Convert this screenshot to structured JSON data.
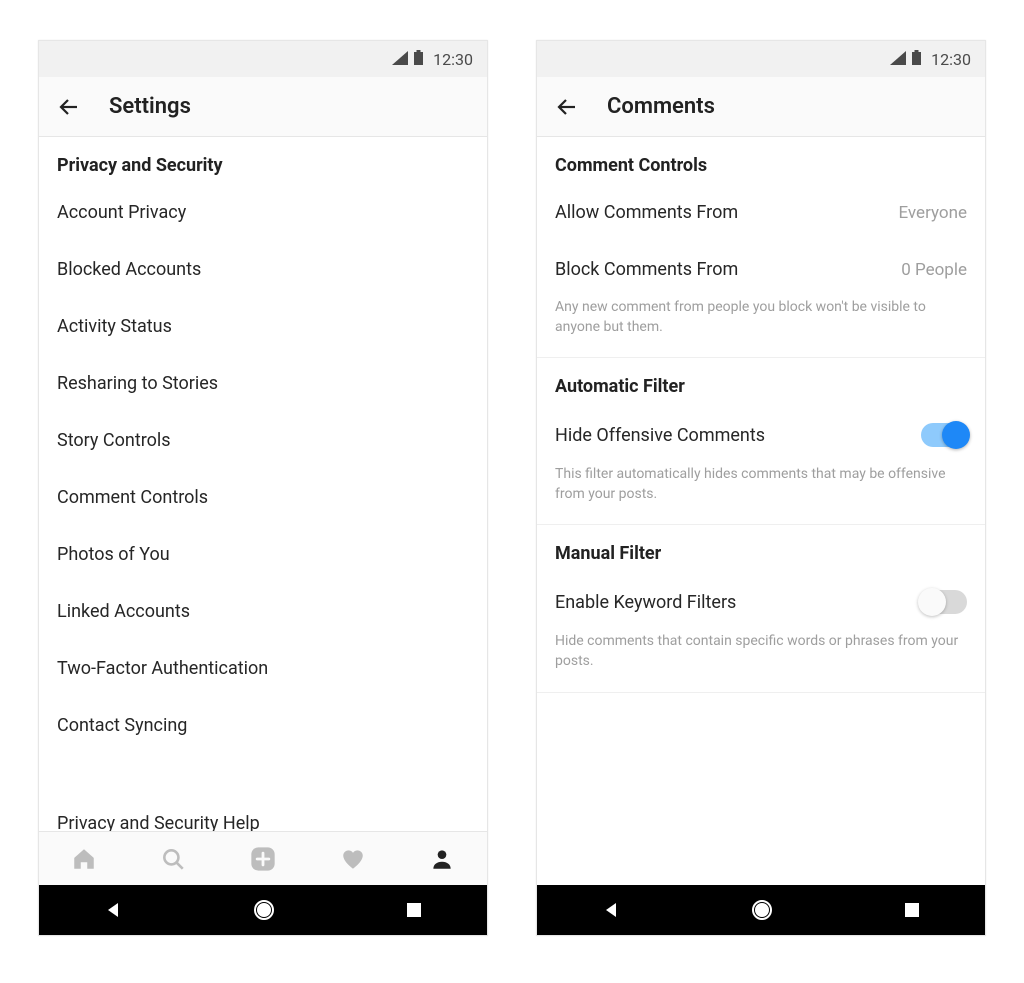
{
  "status": {
    "time": "12:30"
  },
  "left": {
    "header_title": "Settings",
    "section_title": "Privacy and Security",
    "items": [
      "Account Privacy",
      "Blocked Accounts",
      "Activity Status",
      "Resharing to Stories",
      "Story Controls",
      "Comment Controls",
      "Photos of You",
      "Linked Accounts",
      "Two-Factor Authentication",
      "Contact Syncing",
      "Privacy and Security Help"
    ]
  },
  "right": {
    "header_title": "Comments",
    "sections": {
      "comment_controls": {
        "title": "Comment Controls",
        "allow_label": "Allow Comments From",
        "allow_value": "Everyone",
        "block_label": "Block Comments From",
        "block_value": "0 People",
        "block_helper": "Any new comment from people you block won't be visible to anyone but them."
      },
      "automatic_filter": {
        "title": "Automatic Filter",
        "hide_label": "Hide Offensive Comments",
        "hide_on": true,
        "hide_helper": "This filter automatically hides comments that may be offensive from your posts."
      },
      "manual_filter": {
        "title": "Manual Filter",
        "enable_label": "Enable Keyword Filters",
        "enable_on": false,
        "enable_helper": "Hide comments that contain specific words or phrases from your posts."
      }
    }
  }
}
